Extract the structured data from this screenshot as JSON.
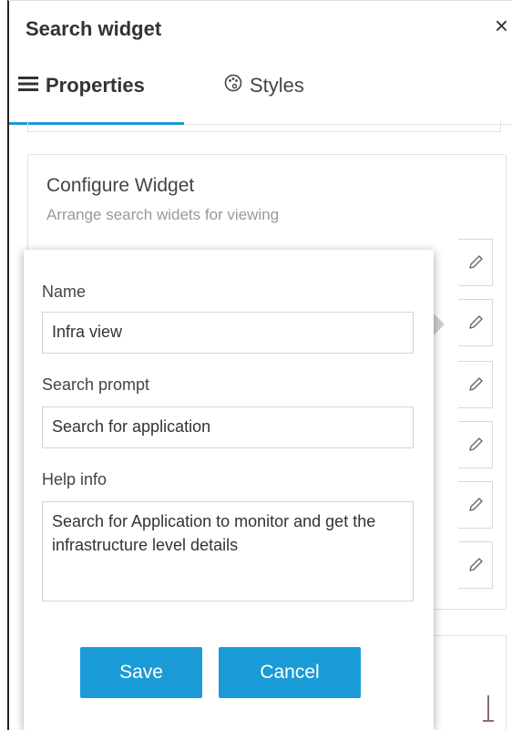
{
  "window": {
    "title": "Search widget",
    "close_glyph": "×"
  },
  "tabs": [
    {
      "label": "Properties",
      "icon": "list-icon",
      "active": true
    },
    {
      "label": "Styles",
      "icon": "palette-icon",
      "active": false
    }
  ],
  "config": {
    "title": "Configure Widget",
    "subtitle": "Arrange search widets for viewing"
  },
  "popup": {
    "name_label": "Name",
    "name_value": "Infra view",
    "prompt_label": "Search prompt",
    "prompt_value": "Search for application",
    "help_label": "Help info",
    "help_value": "Search for Application to monitor and get the infrastructure level details",
    "save_label": "Save",
    "cancel_label": "Cancel"
  },
  "colors": {
    "accent": "#1a9bd7"
  }
}
